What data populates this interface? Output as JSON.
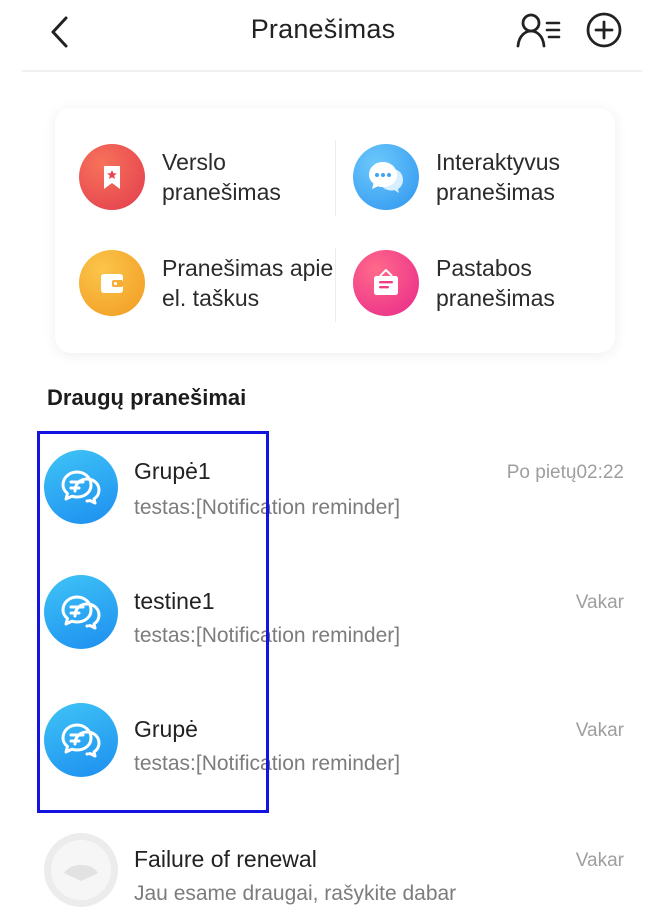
{
  "header": {
    "title": "Pranešimas"
  },
  "categories": [
    {
      "label_line1": "Verslo",
      "label_line2": "pranešimas",
      "icon": "bookmark-icon"
    },
    {
      "label_line1": "Interaktyvus",
      "label_line2": "pranešimas",
      "icon": "chat-bubbles-icon"
    },
    {
      "label_line1": "Pranešimas apie",
      "label_line2": "el. taškus",
      "icon": "wallet-icon"
    },
    {
      "label_line1": "Pastabos",
      "label_line2": "pranešimas",
      "icon": "notice-board-icon"
    }
  ],
  "section": {
    "title": "Draugų pranešimai"
  },
  "conversations": [
    {
      "name": "Grupė1",
      "preview": "testas:[Notification reminder]",
      "time": "Po pietų02:22",
      "avatar": "chat-bubbles-icon"
    },
    {
      "name": "testine1",
      "preview": "testas:[Notification reminder]",
      "time": "Vakar",
      "avatar": "chat-bubbles-icon"
    },
    {
      "name": "Grupė",
      "preview": "testas:[Notification reminder]",
      "time": "Vakar",
      "avatar": "chat-bubbles-icon"
    },
    {
      "name": "Failure of renewal",
      "preview": "Jau esame draugai, rašykite dabar",
      "time": "Vakar",
      "avatar": "default-user-avatar"
    }
  ],
  "colors": {
    "highlight": "#1414e0",
    "business": "#ea4f4f",
    "interactive": "#3aa6f5",
    "points": "#f4a227",
    "notes": "#f0357d",
    "avatar_blue": "#2196f3"
  }
}
